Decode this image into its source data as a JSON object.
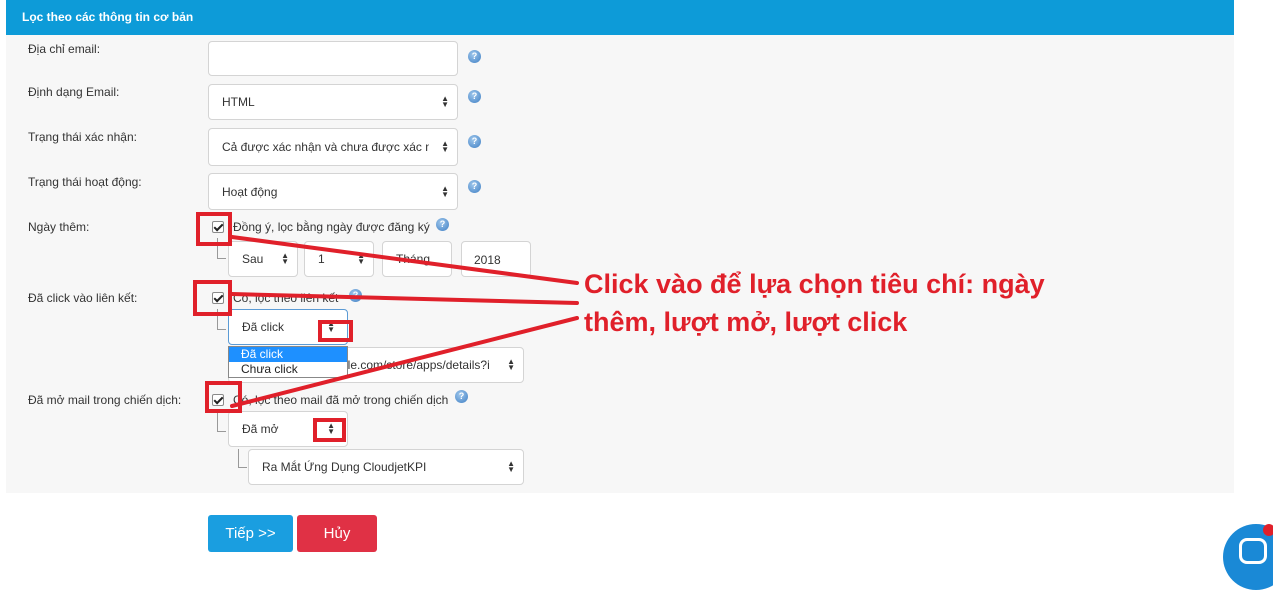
{
  "header": {
    "title": "Lọc theo các thông tin cơ bản"
  },
  "fields": {
    "email": {
      "label": "Địa chỉ email:",
      "value": ""
    },
    "format": {
      "label": "Định dạng Email:",
      "value": "HTML"
    },
    "confirm_status": {
      "label": "Trạng thái xác nhận:",
      "value": "Cả được xác nhận và chưa được xác nh"
    },
    "active_status": {
      "label": "Trạng thái hoạt động:",
      "value": "Hoạt động"
    },
    "date_added": {
      "label": "Ngày thêm:",
      "checkbox_text": "Đồng ý, lọc bằng ngày được đăng ký",
      "checked": true,
      "direction": "Sau",
      "day": "1",
      "month": "Tháng",
      "year": "2018"
    },
    "clicked_link": {
      "label": "Đã click vào liên kết:",
      "checkbox_text": "Có, lọc theo liên kết",
      "checked": true,
      "value": "Đã click",
      "options": [
        "Đã click",
        "Chưa click"
      ],
      "link_value": "gle.com/store/apps/details?i"
    },
    "opened_mail": {
      "label": "Đã mở mail trong chiến dịch:",
      "checkbox_text": "Có, lọc theo mail đã mở trong chiến dịch",
      "checked": true,
      "value": "Đã mở",
      "campaign": "Ra Mắt Ứng Dụng CloudjetKPI"
    }
  },
  "help_icon": "?",
  "annotation": {
    "line1": "Click vào để lựa chọn tiêu chí: ngày",
    "line2": "thêm, lượt mở, lượt click",
    "color": "#e0202a"
  },
  "buttons": {
    "next": "Tiếp >>",
    "cancel": "Hủy"
  },
  "colors": {
    "header": "#0d9bd8",
    "next": "#1a9ee0",
    "cancel": "#e03145"
  }
}
